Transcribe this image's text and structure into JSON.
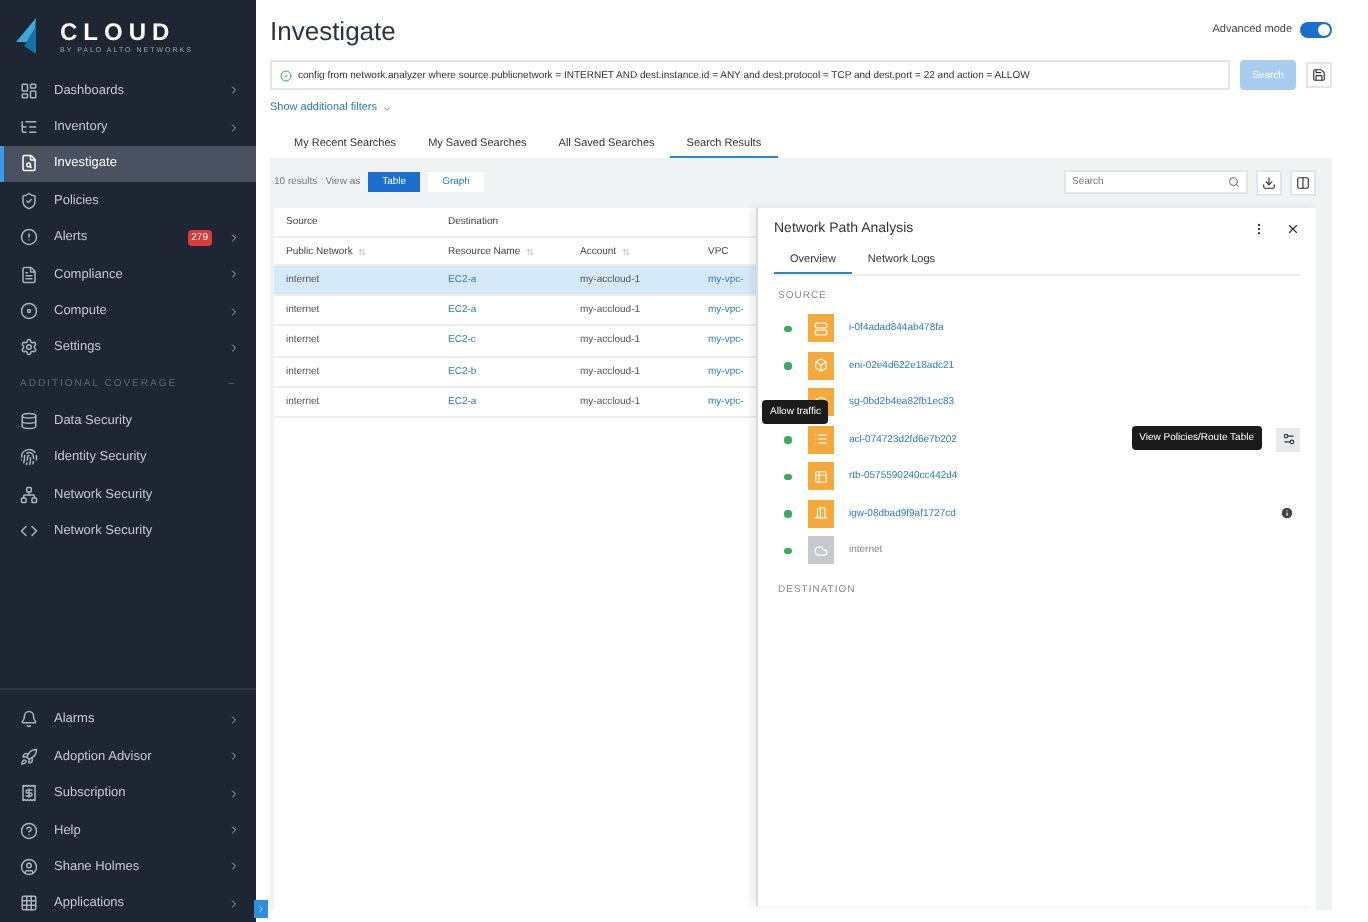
{
  "sidebar": {
    "logo": {
      "name": "CLOUD",
      "tagline": "BY PALO ALTO NETWORKS"
    },
    "items": [
      {
        "label": "Dashboards",
        "chevron": true,
        "selected": false
      },
      {
        "label": "Inventory",
        "chevron": true,
        "selected": false
      },
      {
        "label": "Investigate",
        "chevron": false,
        "selected": true
      },
      {
        "label": "Policies",
        "chevron": false,
        "selected": false
      },
      {
        "label": "Alerts",
        "badge": "279",
        "chevron": true,
        "selected": false
      },
      {
        "label": "Compliance",
        "chevron": true,
        "selected": false
      },
      {
        "label": "Compute",
        "chevron": true,
        "selected": false
      },
      {
        "label": "Settings",
        "chevron": true,
        "selected": false
      }
    ],
    "section": {
      "title": "ADDITIONAL COVERAGE",
      "collapse": "–",
      "expanded": true,
      "items": [
        {
          "label": "Data Security",
          "selected": false
        },
        {
          "label": "Identity Security",
          "selected": false
        },
        {
          "label": "Network Security",
          "selected": false
        },
        {
          "label": "Network Security",
          "selected": false
        }
      ]
    },
    "bottom_items": [
      {
        "label": "Alarms"
      },
      {
        "label": "Adoption Advisor"
      },
      {
        "label": "Subscription"
      },
      {
        "label": "Help"
      },
      {
        "label": "Shane Holmes"
      },
      {
        "label": "Applications"
      }
    ]
  },
  "header": {
    "title": "Investigate",
    "advanced_mode": {
      "label": "Advanced mode",
      "on": true
    }
  },
  "query": {
    "value": "config from network.analyzer where source.publicnetwork = INTERNET AND dest.instance.id = ANY and dest.protocol = TCP and dest.port = 22 and action = ALLOW",
    "search_button": "Search",
    "search_enabled": false
  },
  "filters_link": "Show additional filters",
  "tabs": [
    {
      "label": "My Recent Searches",
      "selected": false
    },
    {
      "label": "My Saved Searches",
      "selected": false
    },
    {
      "label": "All Saved Searches",
      "selected": false
    },
    {
      "label": "Search Results",
      "selected": true
    }
  ],
  "results": {
    "count": "10 results",
    "view_as": "View as",
    "views": [
      {
        "label": "Table",
        "selected": true
      },
      {
        "label": "Graph",
        "selected": false
      }
    ],
    "search_placeholder": "Search"
  },
  "table": {
    "groups": [
      "Source",
      "Destination"
    ],
    "columns": [
      "Public Network",
      "Resource Name",
      "Account",
      "VPC"
    ],
    "rows": [
      {
        "cells": [
          "internet",
          "EC2-a",
          "my-accloud-1",
          "my-vpc-"
        ],
        "selected": true
      },
      {
        "cells": [
          "internet",
          "EC2-a",
          "my-accloud-1",
          "my-vpc-"
        ],
        "selected": false
      },
      {
        "cells": [
          "internet",
          "EC2-c",
          "my-accloud-1",
          "my-vpc-"
        ],
        "selected": false
      },
      {
        "cells": [
          "internet",
          "EC2-b",
          "my-accloud-1",
          "my-vpc-"
        ],
        "selected": false
      },
      {
        "cells": [
          "internet",
          "EC2-a",
          "my-accloud-1",
          "my-vpc-"
        ],
        "selected": false
      }
    ]
  },
  "panel": {
    "title": "Network Path Analysis",
    "tabs": [
      {
        "label": "Overview",
        "selected": true
      },
      {
        "label": "Network Logs",
        "selected": false
      }
    ],
    "source_title": "SOURCE",
    "destination_title": "DESTINATION",
    "nodes": [
      {
        "kind": "instance",
        "label": "i-0f4adad844ab478fa",
        "info": false
      },
      {
        "kind": "eni",
        "label": "eni-02e4d622e18adc21",
        "info": false
      },
      {
        "kind": "sg",
        "label": "sg-0bd2b4ea82fb1ec83",
        "info": false
      },
      {
        "kind": "acl",
        "label": "acl-074723d2fd6e7b202",
        "tooltip": "Allow traffic",
        "action_tooltip": "View Policies/Route Table",
        "info": false
      },
      {
        "kind": "rtb",
        "label": "rtb-0575590240cc442d4",
        "info": false
      },
      {
        "kind": "igw",
        "label": "igw-08dbad9f9af1727cd",
        "info": true
      },
      {
        "kind": "internet",
        "label": "internet",
        "info": false
      }
    ]
  }
}
